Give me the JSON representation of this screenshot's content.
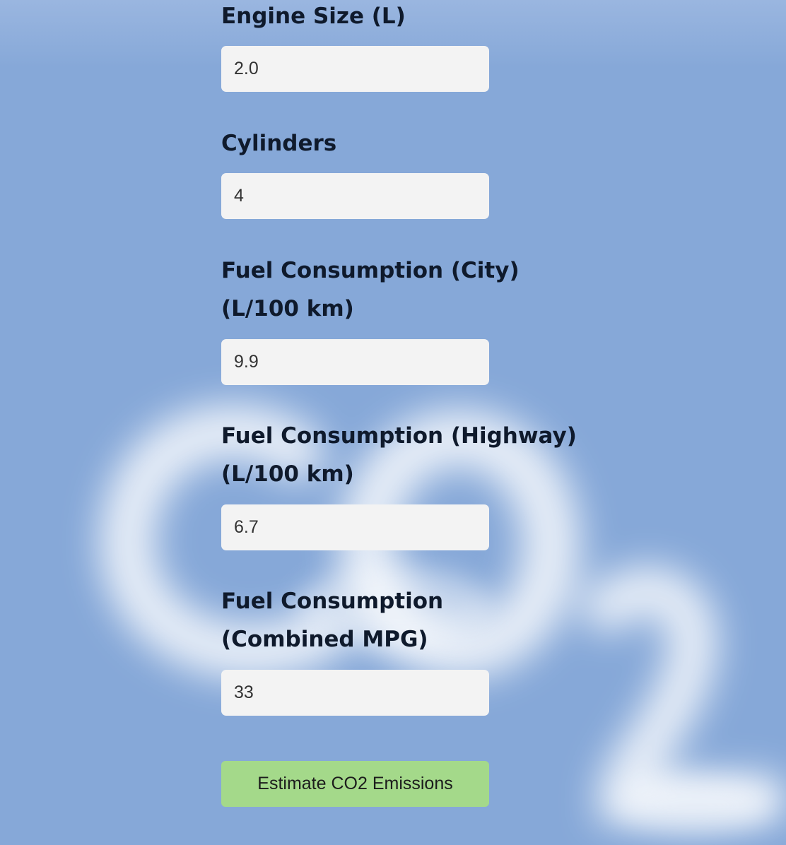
{
  "fields": [
    {
      "label": "Engine Size (L)",
      "value": "2.0"
    },
    {
      "label": "Cylinders",
      "value": "4"
    },
    {
      "label_line1": "Fuel Consumption (City)",
      "label_line2": "(L/100 km)",
      "value": "9.9"
    },
    {
      "label_line1": "Fuel Consumption (Highway)",
      "label_line2": "(L/100 km)",
      "value": "6.7"
    },
    {
      "label_line1": "Fuel Consumption",
      "label_line2": "(Combined MPG)",
      "value": "33"
    }
  ],
  "submit_label": "Estimate CO2 Emissions",
  "colors": {
    "background": "#86a8d8",
    "input_background": "#f3f3f3",
    "button_background": "#a4d98a",
    "label_text": "#0f1a2c"
  },
  "background_art": "co2-cloud-illustration"
}
